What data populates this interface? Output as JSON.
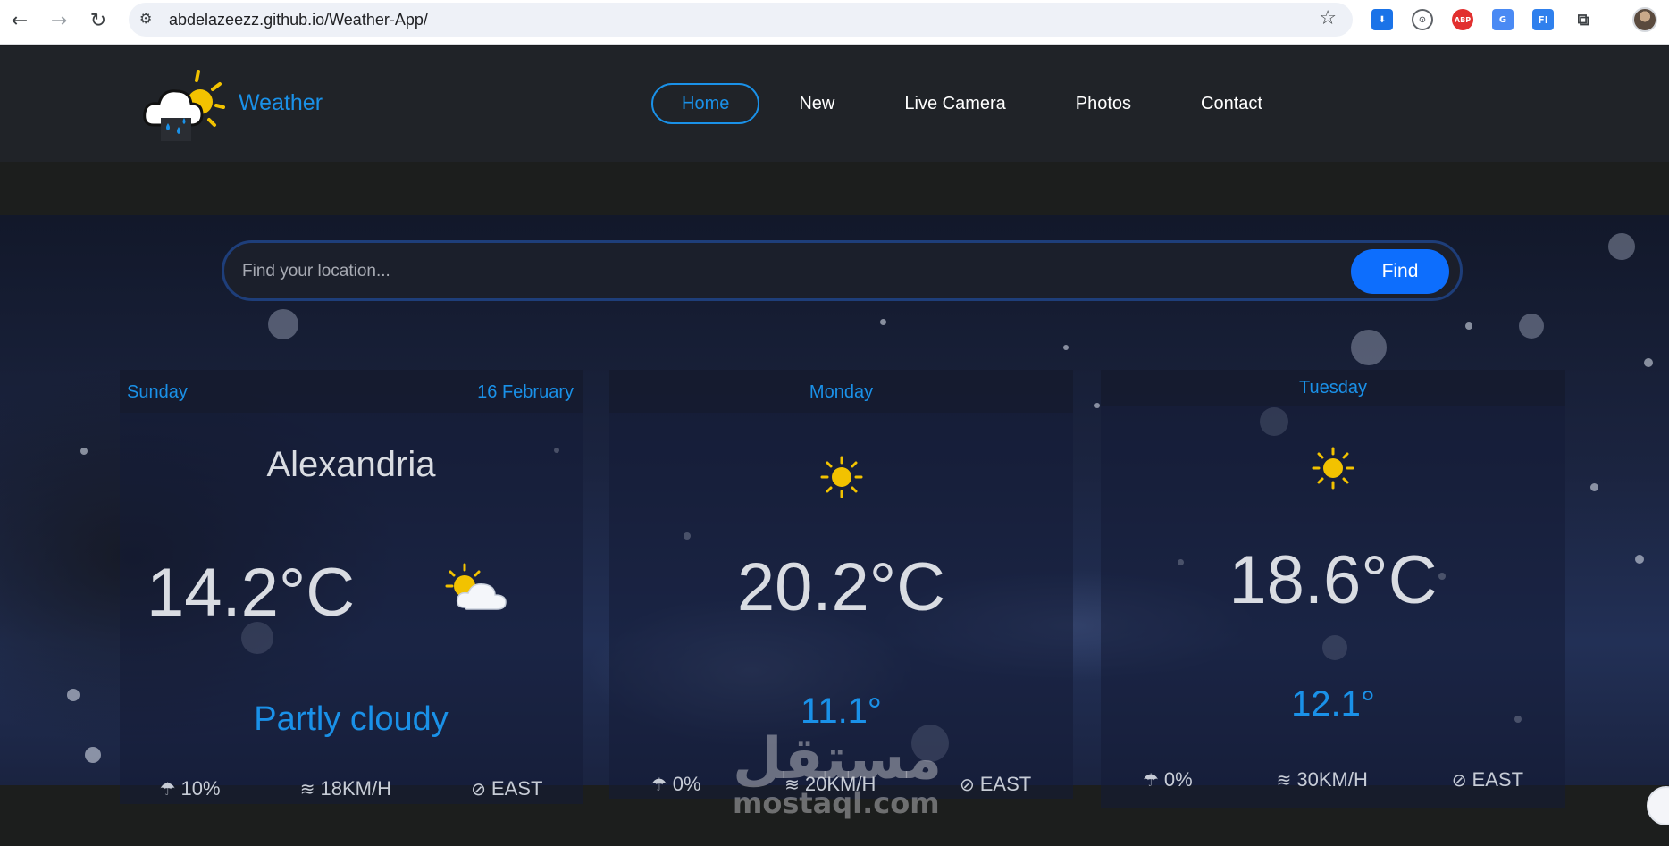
{
  "browser": {
    "url": "abdelazeezz.github.io/Weather-App/",
    "back_icon": "arrow-left-icon",
    "forward_icon": "arrow-right-icon",
    "reload_icon": "reload-icon",
    "bookmark_icon": "star-icon",
    "extensions": [
      {
        "name": "download-icon",
        "label": "⬇",
        "color": "#1a73e8"
      },
      {
        "name": "code-icon",
        "label": "⊙",
        "color": "#5f6368"
      },
      {
        "name": "adblock-icon",
        "label": "ABP",
        "color": "#e2302f"
      },
      {
        "name": "translate-icon",
        "label": "G",
        "color": "#4a8af4"
      },
      {
        "name": "fi-icon",
        "label": "FI",
        "color": "#2f80ed"
      },
      {
        "name": "puzzle-icon",
        "label": "⧉",
        "color": "#5f6368"
      }
    ]
  },
  "header": {
    "brand": "Weather",
    "nav": [
      "Home",
      "New",
      "Live Camera",
      "Photos",
      "Contact"
    ],
    "active_nav": "Home",
    "accent": "#1a91e8"
  },
  "search": {
    "placeholder": "Find your location...",
    "button": "Find"
  },
  "today": {
    "day": "Sunday",
    "date": "16 February",
    "city": "Alexandria",
    "temp": "14.2°C",
    "icon": "partly-cloudy-icon",
    "condition": "Partly cloudy",
    "rain": "10%",
    "wind": "18KM/H",
    "direction": "EAST"
  },
  "forecast": [
    {
      "day": "Monday",
      "icon": "sun-icon",
      "max": "20.2°C",
      "min": "11.1°",
      "rain": "0%",
      "wind": "20KM/H",
      "direction": "EAST"
    },
    {
      "day": "Tuesday",
      "icon": "sun-icon",
      "max": "18.6°C",
      "min": "12.1°",
      "rain": "0%",
      "wind": "30KM/H",
      "direction": "EAST"
    }
  ],
  "watermark": {
    "arabic": "مستقل",
    "latin": "mostaql.com"
  }
}
